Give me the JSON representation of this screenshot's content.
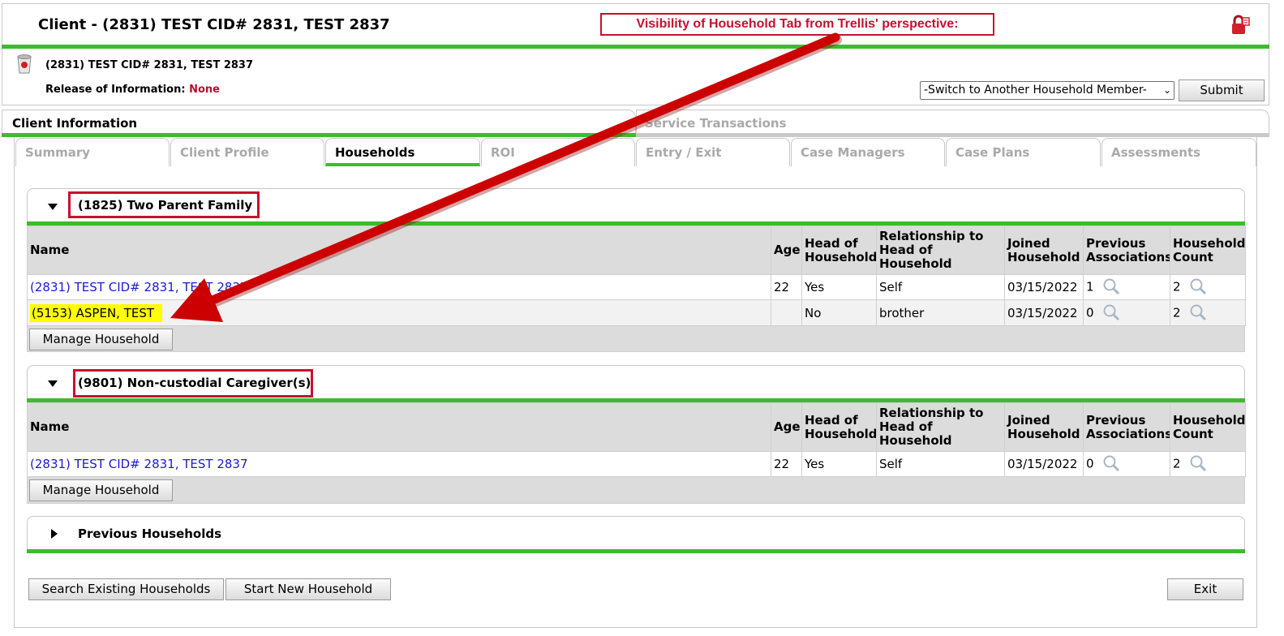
{
  "header": {
    "title": "Client - (2831) TEST CID# 2831, TEST 2837",
    "annotation": "Visibility of Household Tab from Trellis' perspective:",
    "client_name": "(2831) TEST CID# 2831, TEST 2837",
    "roi_label": "Release of Information:",
    "roi_value": "None",
    "member_select": "-Switch to Another Household Member-",
    "submit": "Submit"
  },
  "main_tabs": [
    "Client Information",
    "Service Transactions"
  ],
  "sub_tabs": [
    "Summary",
    "Client Profile",
    "Households",
    "ROI",
    "Entry / Exit",
    "Case Managers",
    "Case Plans",
    "Assessments"
  ],
  "table_headers": {
    "name": "Name",
    "age": "Age",
    "head": [
      "Head of",
      "Household"
    ],
    "relationship": [
      "Relationship to",
      "Head of",
      "Household"
    ],
    "joined": [
      "Joined",
      "Household"
    ],
    "previous": [
      "Previous",
      "Associations"
    ],
    "count": [
      "Household",
      "Count"
    ]
  },
  "households": [
    {
      "title": "(1825) Two Parent Family",
      "rows": [
        {
          "name": "(2831) TEST CID# 2831, TEST 2837",
          "age": "22",
          "head": "Yes",
          "relationship": "Self",
          "joined": "03/15/2022",
          "previous": "1",
          "count": "2"
        },
        {
          "name": "(5153) ASPEN, TEST",
          "age": "",
          "head": "No",
          "relationship": "brother",
          "joined": "03/15/2022",
          "previous": "0",
          "count": "2"
        }
      ],
      "manage": "Manage Household"
    },
    {
      "title": "(9801) Non-custodial Caregiver(s)",
      "rows": [
        {
          "name": "(2831) TEST CID# 2831, TEST 2837",
          "age": "22",
          "head": "Yes",
          "relationship": "Self",
          "joined": "03/15/2022",
          "previous": "0",
          "count": "2"
        }
      ],
      "manage": "Manage Household"
    }
  ],
  "previous_households": "Previous Households",
  "buttons": {
    "search": "Search Existing Households",
    "start": "Start New Household",
    "exit": "Exit"
  },
  "colors": {
    "accent_green": "#3dbb2f",
    "annotation_red": "#c8102e",
    "link_blue": "#1b1bd0",
    "highlight_yellow": "#ffff00"
  }
}
